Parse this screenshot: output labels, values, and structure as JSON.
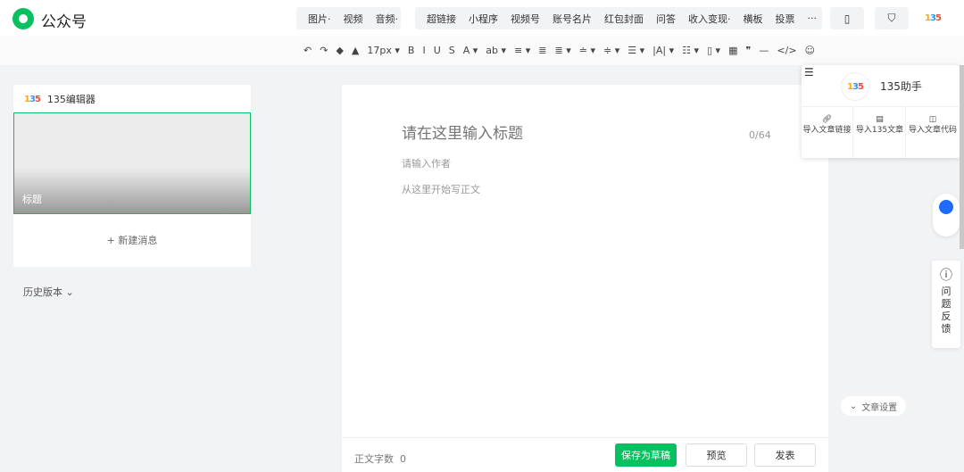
{
  "header": {
    "brand": "公众号",
    "menu1": [
      "图片·",
      "视频",
      "音频·"
    ],
    "menu2": [
      "超链接",
      "小程序",
      "视频号",
      "账号名片",
      "红包封面",
      "问答",
      "收入变现·",
      "横板",
      "投票",
      "···"
    ]
  },
  "toolbar": {
    "font_size": "17px",
    "items": [
      "↶",
      "↷",
      "◆",
      "▲",
      "17px ▾",
      "B",
      "I",
      "U",
      "S",
      "A ▾",
      "ab ▾",
      "≡ ▾",
      "≣",
      "≣ ▾",
      "≐ ▾",
      "≑ ▾",
      "☰ ▾",
      "|A| ▾",
      "☷ ▾",
      "▯ ▾",
      "▦",
      "❞",
      "—",
      "</>",
      "☺"
    ]
  },
  "left": {
    "editor_name": "135编辑器",
    "cover_title": "标题",
    "new_message": "+ 新建消息",
    "history": "历史版本 ⌄"
  },
  "editor": {
    "title_placeholder": "请在这里输入标题",
    "title_count": "0/64",
    "author_placeholder": "请输入作者",
    "body_placeholder": "从这里开始写正文",
    "word_count_label": "正文字数",
    "word_count": "0",
    "save_draft": "保存为草稿",
    "preview": "预览",
    "publish": "发表"
  },
  "helper": {
    "logo": "135",
    "name": "135助手",
    "actions": [
      "导入文章链接",
      "导入135文章",
      "导入文章代码"
    ]
  },
  "side": {
    "feedback": "问题反馈",
    "settings": "文章设置"
  },
  "colors": {
    "accent": "#07c160"
  }
}
